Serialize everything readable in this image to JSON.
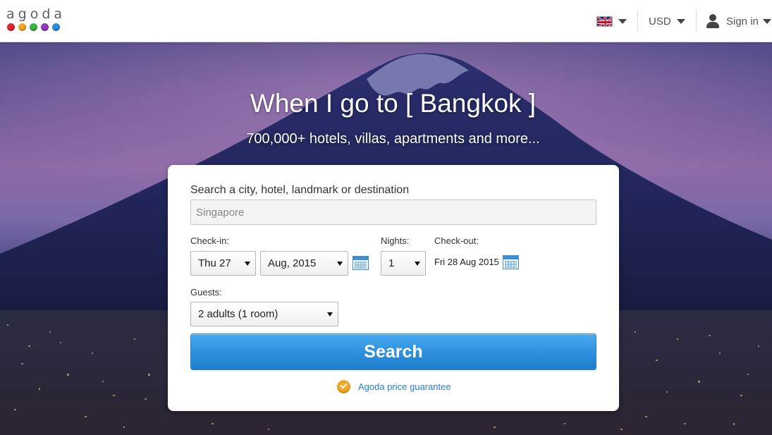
{
  "header": {
    "logo_text": "agoda",
    "logo_dot_colors": [
      "#e3262e",
      "#f5a623",
      "#3cb54a",
      "#8e3bbf",
      "#2a8fe0"
    ],
    "language_icon": "uk-flag-icon",
    "currency": "USD",
    "signin_label": "Sign in"
  },
  "hero": {
    "headline": "When I go to [ Bangkok ]",
    "subheadline": "700,000+ hotels, villas, apartments and more..."
  },
  "search": {
    "destination_label": "Search a city, hotel, landmark or destination",
    "destination_placeholder": "Singapore",
    "checkin_label": "Check-in:",
    "checkin_day": "Thu 27",
    "checkin_month": "Aug, 2015",
    "nights_label": "Nights:",
    "nights_value": "1",
    "checkout_label": "Check-out:",
    "checkout_value": "Fri 28 Aug 2015",
    "guests_label": "Guests:",
    "guests_value": "2 adults (1 room)",
    "search_button": "Search",
    "guarantee_link": "Agoda price guarantee"
  },
  "colors": {
    "accent_blue": "#2f91df",
    "link_blue": "#2a7fcf",
    "badge_orange": "#f0a826"
  }
}
